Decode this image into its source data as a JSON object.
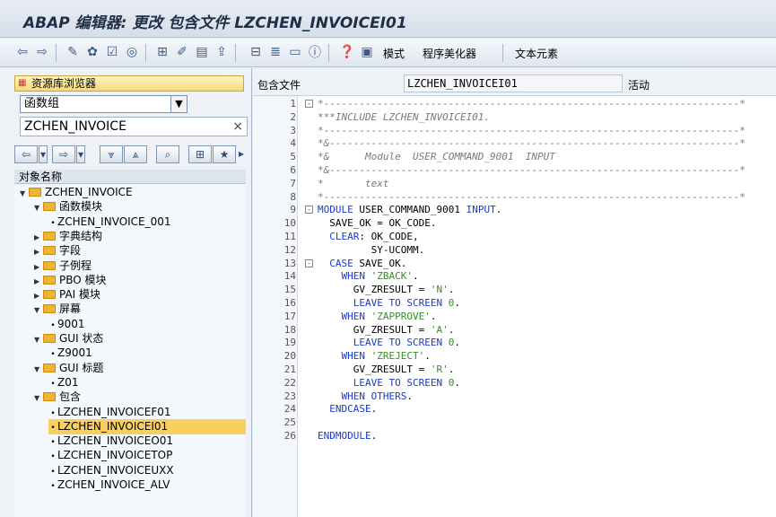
{
  "window": {
    "title": "ABAP 编辑器: 更改 包含文件 LZCHEN_INVOICEI01"
  },
  "toolbar": {
    "buttons": [
      "back-icon",
      "forward-icon",
      "display-change-icon",
      "activate-icon",
      "check-icon",
      "where-used-icon",
      "object-list-icon",
      "pencil-icon",
      "navigate-icon",
      "upload-icon",
      "hierarchy-icon",
      "pattern-icon",
      "info-icon",
      "help-icon",
      "print-icon",
      "test-icon"
    ],
    "pattern_label": "模式",
    "pretty_printer_label": "程序美化器",
    "text_elements_label": "文本元素"
  },
  "left": {
    "repo_browser_label": "资源库浏览器",
    "object_type": "函数组",
    "object_name": "ZCHEN_INVOICE",
    "tree_header": "对象名称",
    "tree": [
      {
        "label": "ZCHEN_INVOICE",
        "level": 0,
        "type": "folder",
        "open": true
      },
      {
        "label": "函数模块",
        "level": 1,
        "type": "folder",
        "open": true
      },
      {
        "label": "ZCHEN_INVOICE_001",
        "level": 2,
        "type": "leaf"
      },
      {
        "label": "字典结构",
        "level": 1,
        "type": "folder",
        "open": false
      },
      {
        "label": "字段",
        "level": 1,
        "type": "folder",
        "open": false
      },
      {
        "label": "子例程",
        "level": 1,
        "type": "folder",
        "open": false
      },
      {
        "label": "PBO 模块",
        "level": 1,
        "type": "folder",
        "open": false
      },
      {
        "label": "PAI 模块",
        "level": 1,
        "type": "folder",
        "open": false
      },
      {
        "label": "屏幕",
        "level": 1,
        "type": "folder",
        "open": true
      },
      {
        "label": "9001",
        "level": 2,
        "type": "leaf"
      },
      {
        "label": "GUI 状态",
        "level": 1,
        "type": "folder",
        "open": true
      },
      {
        "label": "Z9001",
        "level": 2,
        "type": "leaf"
      },
      {
        "label": "GUI 标题",
        "level": 1,
        "type": "folder",
        "open": true
      },
      {
        "label": "Z01",
        "level": 2,
        "type": "leaf"
      },
      {
        "label": "包含",
        "level": 1,
        "type": "folder",
        "open": true
      },
      {
        "label": "LZCHEN_INVOICEF01",
        "level": 2,
        "type": "leaf"
      },
      {
        "label": "LZCHEN_INVOICEI01",
        "level": 2,
        "type": "leaf",
        "selected": true
      },
      {
        "label": "LZCHEN_INVOICEO01",
        "level": 2,
        "type": "leaf"
      },
      {
        "label": "LZCHEN_INVOICETOP",
        "level": 2,
        "type": "leaf"
      },
      {
        "label": "LZCHEN_INVOICEUXX",
        "level": 2,
        "type": "leaf"
      },
      {
        "label": "ZCHEN_INVOICE_ALV",
        "level": 2,
        "type": "leaf"
      }
    ]
  },
  "right": {
    "include_label": "包含文件",
    "include_name": "LZCHEN_INVOICEI01",
    "status": "活动"
  },
  "editor": {
    "lines": [
      {
        "n": "1",
        "text": "*----------------------------------------------------------------------*",
        "kind": "comment",
        "fold": "-"
      },
      {
        "n": "2",
        "text": "***INCLUDE LZCHEN_INVOICEI01.",
        "kind": "comment"
      },
      {
        "n": "3",
        "text": "*----------------------------------------------------------------------*",
        "kind": "comment"
      },
      {
        "n": "4",
        "text": "*&---------------------------------------------------------------------*",
        "kind": "comment"
      },
      {
        "n": "5",
        "text": "*&      Module  USER_COMMAND_9001  INPUT",
        "kind": "comment"
      },
      {
        "n": "6",
        "text": "*&---------------------------------------------------------------------*",
        "kind": "comment"
      },
      {
        "n": "7",
        "text": "*       text",
        "kind": "comment"
      },
      {
        "n": "8",
        "text": "*----------------------------------------------------------------------*",
        "kind": "comment"
      },
      {
        "n": "9",
        "text": "MODULE USER_COMMAND_9001 INPUT.",
        "kind": "code",
        "fold": "-"
      },
      {
        "n": "10",
        "text": "  SAVE_OK = OK_CODE.",
        "kind": "code"
      },
      {
        "n": "11",
        "text": "  CLEAR: OK_CODE,",
        "kind": "code"
      },
      {
        "n": "12",
        "text": "         SY-UCOMM.",
        "kind": "code"
      },
      {
        "n": "13",
        "text": "  CASE SAVE_OK.",
        "kind": "code",
        "fold": "-"
      },
      {
        "n": "14",
        "text": "    WHEN 'ZBACK'.",
        "kind": "code"
      },
      {
        "n": "15",
        "text": "      GV_ZRESULT = 'N'.",
        "kind": "code"
      },
      {
        "n": "16",
        "text": "      LEAVE TO SCREEN 0.",
        "kind": "code"
      },
      {
        "n": "17",
        "text": "    WHEN 'ZAPPROVE'.",
        "kind": "code"
      },
      {
        "n": "18",
        "text": "      GV_ZRESULT = 'A'.",
        "kind": "code"
      },
      {
        "n": "19",
        "text": "      LEAVE TO SCREEN 0.",
        "kind": "code"
      },
      {
        "n": "20",
        "text": "    WHEN 'ZREJECT'.",
        "kind": "code"
      },
      {
        "n": "21",
        "text": "      GV_ZRESULT = 'R'.",
        "kind": "code"
      },
      {
        "n": "22",
        "text": "      LEAVE TO SCREEN 0.",
        "kind": "code"
      },
      {
        "n": "23",
        "text": "    WHEN OTHERS.",
        "kind": "code"
      },
      {
        "n": "24",
        "text": "  ENDCASE.",
        "kind": "code"
      },
      {
        "n": "25",
        "text": "",
        "kind": "code"
      },
      {
        "n": "26",
        "text": "ENDMODULE.",
        "kind": "code"
      }
    ]
  },
  "colors": {
    "keyword": "#1a3ac9",
    "string": "#3a8a2a",
    "comment": "#7a7a7a",
    "selection": "#f9cf5d"
  }
}
